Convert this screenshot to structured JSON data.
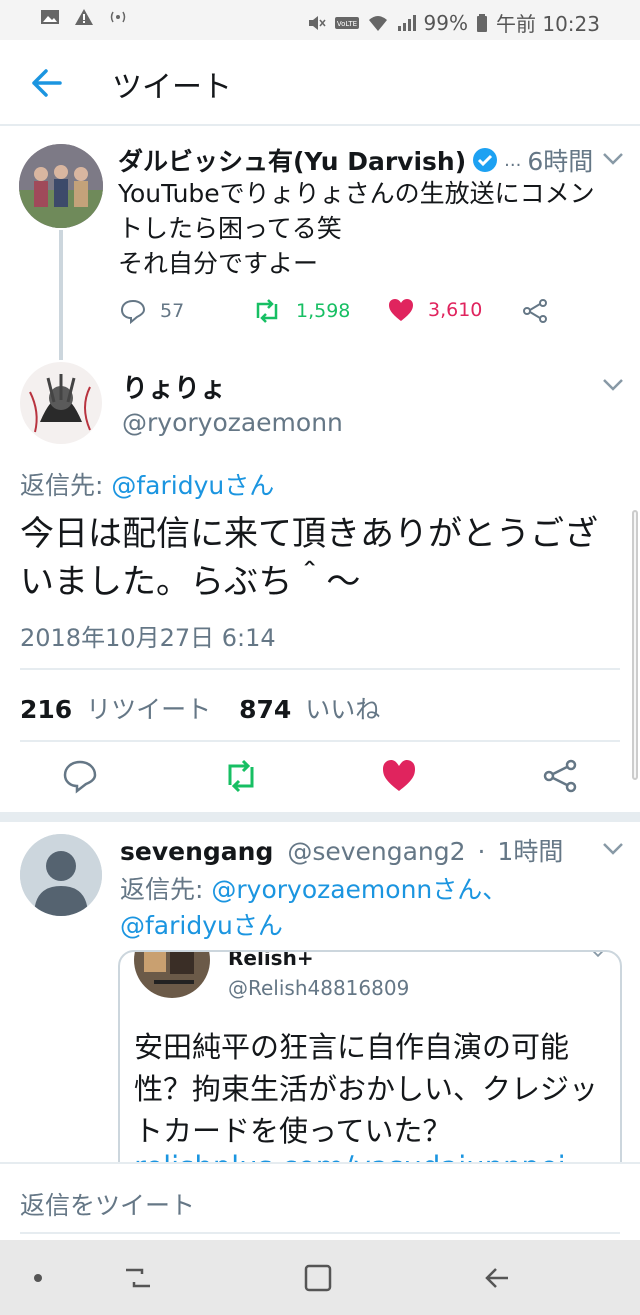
{
  "status_bar": {
    "battery": "99%",
    "time": "午前 10:23",
    "icons": [
      "image-icon",
      "warning-icon",
      "nfc-icon",
      "mute-icon",
      "volte-icon",
      "wifi-icon",
      "signal-icon",
      "battery-icon"
    ]
  },
  "header": {
    "title": "ツイート"
  },
  "tweet1": {
    "display_name": "ダルビッシュ有(Yu Darvish)",
    "verified": true,
    "ellipsis": "...",
    "time": "6時間",
    "text_lines": [
      "YouTubeでりょりょさんの生放送にコメン",
      "トしたら困ってる笑",
      "それ自分ですよー"
    ],
    "replies": "57",
    "retweets": "1,598",
    "likes": "3,610"
  },
  "main_tweet": {
    "display_name": "りょりょ",
    "handle": "@ryoryozaemonn",
    "reply_to_label": "返信先: ",
    "reply_to_handle": "@faridyuさん",
    "text": "今日は配信に来て頂きありがとうございました。らぶち＾～",
    "date": "2018年10月27日 6:14",
    "retweet_count": "216",
    "retweet_label": "リツイート",
    "like_count": "874",
    "like_label": "いいね"
  },
  "reply_tweet": {
    "display_name": "sevengang",
    "handle": "@sevengang2",
    "separator": "·",
    "time": "1時間",
    "reply_to_label": "返信先: ",
    "reply_to_handle1": "@ryoryozaemonnさん、",
    "reply_to_handle2": "@faridyuさん",
    "quote": {
      "display_name": "Relish+",
      "handle": "@Relish48816809",
      "text": "安田純平の狂言に自作自演の可能性？拘束生活がおかしい、クレジットカードを使っていた？",
      "link": "relishplus.com/yasudaiunnpei"
    }
  },
  "reply_bar": {
    "placeholder": "返信をツイート"
  },
  "colors": {
    "accent": "#1b95e0",
    "retweet": "#17bf63",
    "like": "#e0245e",
    "muted": "#657786",
    "border": "#e6ecf0"
  }
}
